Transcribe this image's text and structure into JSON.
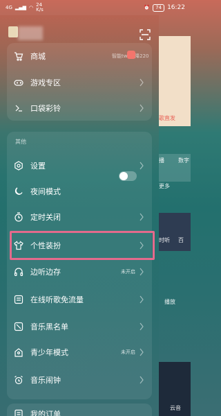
{
  "status_bar": {
    "network": "4G",
    "speed": "24\nK/s",
    "battery": "74",
    "time": "16:22"
  },
  "drawer": {
    "promo_text": "智能tws直降220",
    "top_items": [
      {
        "label": "商城"
      },
      {
        "label": "游戏专区"
      },
      {
        "label": "口袋彩铃"
      }
    ],
    "section_label": "其他",
    "items": [
      {
        "label": "设置",
        "state": ""
      },
      {
        "label": "夜间模式",
        "state": ""
      },
      {
        "label": "定时关闭",
        "state": ""
      },
      {
        "label": "个性装扮",
        "state": ""
      },
      {
        "label": "边听边存",
        "state": "未开启"
      },
      {
        "label": "在线听歌免流量",
        "state": ""
      },
      {
        "label": "音乐黑名单",
        "state": ""
      },
      {
        "label": "青少年模式",
        "state": "未开启"
      },
      {
        "label": "音乐闹钟",
        "state": ""
      }
    ],
    "bottom_item": {
      "label": "我的订单"
    }
  },
  "background_app": {
    "labels": [
      "歌直发",
      "播",
      "数字",
      "更多",
      "时听",
      "百",
      "播放",
      "云音"
    ]
  }
}
